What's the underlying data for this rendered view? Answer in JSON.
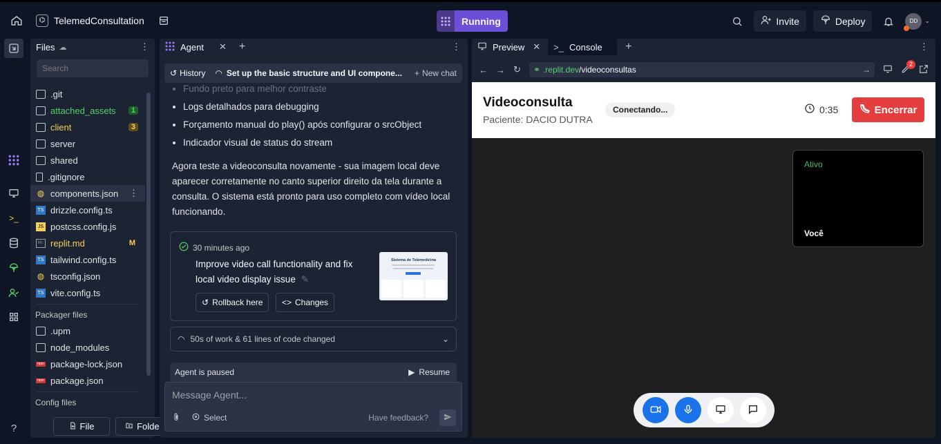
{
  "topbar": {
    "project_name": "TelemedConsultation",
    "run_status": "Running",
    "invite_label": "Invite",
    "deploy_label": "Deploy",
    "avatar_initials": "DD"
  },
  "files": {
    "title": "Files",
    "search_placeholder": "Search",
    "items": [
      {
        "name": ".git",
        "type": "folder"
      },
      {
        "name": "attached_assets",
        "type": "folder",
        "badge": "1",
        "color": "#58d26a"
      },
      {
        "name": "client",
        "type": "folder",
        "badge": "3",
        "color": "#f2d05a"
      },
      {
        "name": "server",
        "type": "folder"
      },
      {
        "name": "shared",
        "type": "folder"
      },
      {
        "name": ".gitignore",
        "type": "file"
      },
      {
        "name": "components.json",
        "type": "json"
      },
      {
        "name": "drizzle.config.ts",
        "type": "ts"
      },
      {
        "name": "postcss.config.js",
        "type": "js"
      },
      {
        "name": "replit.md",
        "type": "md",
        "badge": "M",
        "color": "#f2d05a"
      },
      {
        "name": "tailwind.config.ts",
        "type": "ts"
      },
      {
        "name": "tsconfig.json",
        "type": "json"
      },
      {
        "name": "vite.config.ts",
        "type": "ts"
      }
    ],
    "packager_title": "Packager files",
    "packager_items": [
      {
        "name": ".upm",
        "type": "folder"
      },
      {
        "name": "node_modules",
        "type": "folder"
      },
      {
        "name": "package-lock.json",
        "type": "npm"
      },
      {
        "name": "package.json",
        "type": "npm"
      }
    ],
    "config_title": "Config files",
    "new_file_label": "File",
    "new_folder_label": "Folder"
  },
  "agent": {
    "tab_label": "Agent",
    "history_label": "History",
    "chat_title": "Set up the basic structure and UI compone...",
    "new_chat_label": "New chat",
    "bullets": [
      "Fundo preto para melhor contraste",
      "Logs detalhados para debugging",
      "Forçamento manual do play() após configurar o srcObject",
      "Indicador visual de status do stream"
    ],
    "paragraph": "Agora teste a videoconsulta novamente - sua imagem local deve aparecer corretamente no canto superior direito da tela durante a consulta. O sistema está pronto para uso completo com vídeo local funcionando.",
    "checkpoint": {
      "time": "30 minutes ago",
      "title": "Improve video call functionality and fix local video display issue",
      "rollback_label": "Rollback here",
      "changes_label": "Changes",
      "thumb_title": "Sistema de Telemedicina"
    },
    "work_summary": "50s of work & 61 lines of code changed",
    "paused_label": "Agent is paused",
    "resume_label": "Resume",
    "input_placeholder": "Message Agent...",
    "select_label": "Select",
    "feedback_label": "Have feedback?"
  },
  "preview": {
    "tab_preview": "Preview",
    "tab_console": "Console",
    "url_domain": ".replit.dev",
    "url_path": "/videoconsultas",
    "notification_count": "2"
  },
  "app": {
    "title": "Videoconsulta",
    "patient": "Paciente: DACIO DUTRA",
    "status": "Conectando...",
    "timer": "0:35",
    "end_label": "Encerrar",
    "local_status": "Ativo",
    "local_label": "Você"
  },
  "colors": {
    "accent": "#6b4fd8",
    "end_button": "#e53e3e",
    "active_control": "#1a73e8"
  }
}
